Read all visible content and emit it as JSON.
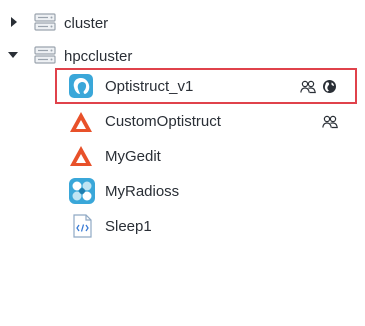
{
  "tree": {
    "clusters": [
      {
        "label": "cluster",
        "expanded": false,
        "icon": "server-icon"
      },
      {
        "label": "hpccluster",
        "expanded": true,
        "icon": "server-icon",
        "apps": [
          {
            "label": "Optistruct_v1",
            "icon": "optistruct-icon",
            "selected": true,
            "shared": true,
            "public": true
          },
          {
            "label": "CustomOptistruct",
            "icon": "altair-delta-icon",
            "selected": false,
            "shared": true,
            "public": false
          },
          {
            "label": "MyGedit",
            "icon": "altair-delta-icon",
            "selected": false,
            "shared": false,
            "public": false
          },
          {
            "label": "MyRadioss",
            "icon": "radioss-icon",
            "selected": false,
            "shared": false,
            "public": false
          },
          {
            "label": "Sleep1",
            "icon": "code-file-icon",
            "selected": false,
            "shared": false,
            "public": false
          }
        ]
      }
    ]
  },
  "colors": {
    "selection_border": "#e0424b",
    "altair_orange": "#e8512a",
    "optistruct_blue": "#3aa7d9",
    "server_gray": "#9aa3ad"
  }
}
